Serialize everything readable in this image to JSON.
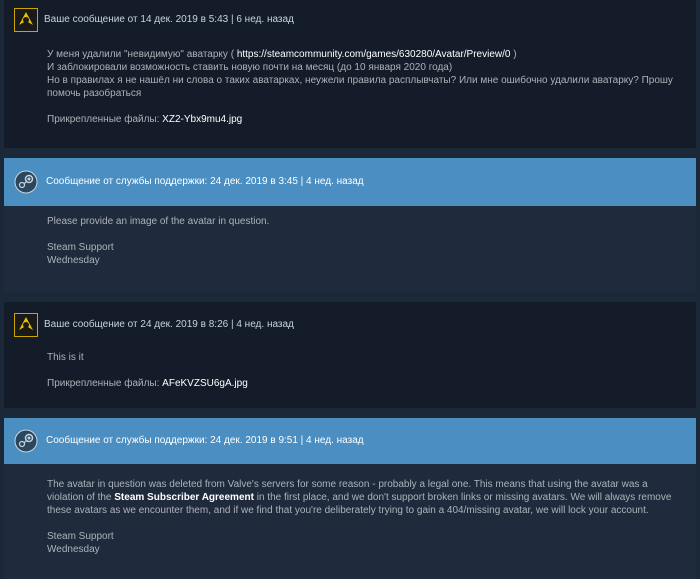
{
  "messages": [
    {
      "header": "Ваше сообщение от 14 дек. 2019 в 5:43 | 6 нед. назад",
      "lines": [
        "У меня удалили \"невидимую\" аватарку ( ",
        "https://steamcommunity.com/games/630280/Avatar/Preview/0",
        " )",
        "И заблокировали возможность ставить новую почти на месяц (до 10 января 2020 года)",
        "Но в правилах я не нашёл ни слова о таких аватарках, неужели правила расплывчаты? Или мне ошибочно удалили аватарку? Прошу",
        "помочь разобраться"
      ],
      "attach_label": "Прикрепленные файлы: ",
      "attach_file": "XZ2-Ybx9mu4.jpg"
    },
    {
      "header": "Сообщение от службы поддержки: 24 дек. 2019 в 3:45 | 4 нед. назад",
      "lines": [
        "Please provide an image of the avatar in question.",
        "Steam Support",
        "Wednesday"
      ]
    },
    {
      "header": "Ваше сообщение от 24 дек. 2019 в 8:26 | 4 нед. назад",
      "lines": [
        "This is it"
      ],
      "attach_label": "Прикрепленные файлы: ",
      "attach_file": "AFeKVZSU6gA.jpg"
    },
    {
      "header": "Сообщение от службы поддержки: 24 дек. 2019 в 9:51 | 4 нед. назад",
      "line1": "The avatar in question was deleted from Valve's servers for some reason - probably a legal one. This means that using the avatar was a",
      "line2_a": "violation of the ",
      "line2_b": "Steam Subscriber Agreement",
      "line2_c": " in the first place, and we don't support broken links or missing avatars. We will always remove",
      "line3": "these avatars as we encounter them, and if we find that you're deliberately trying to gain a 404/missing avatar, we will lock your account.",
      "sig1": "Steam Support",
      "sig2": "Wednesday"
    }
  ],
  "colors": {
    "background": "#1b2838",
    "support_header": "#4a8ec2",
    "user_panel": "#131c28",
    "support_panel": "#1f2b3d"
  },
  "icons": {
    "user_avatar": "yellow-pac-avatar-icon",
    "support_avatar": "steam-logo-icon"
  }
}
